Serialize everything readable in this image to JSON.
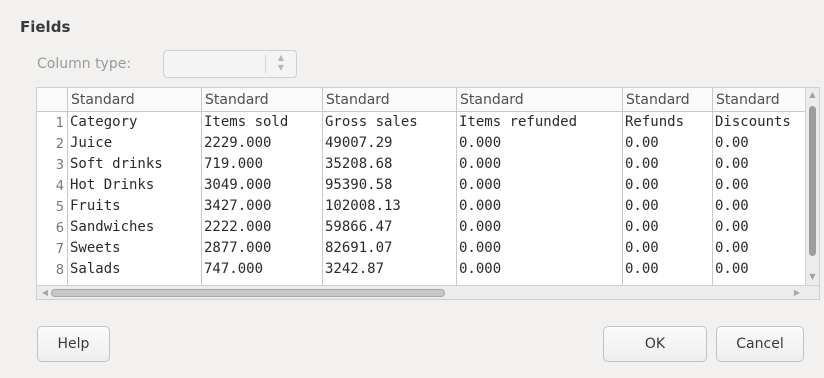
{
  "dialog": {
    "section_title": "Fields",
    "column_type_label": "Column type:",
    "column_type_value": ""
  },
  "grid": {
    "column_types": [
      "Standard",
      "Standard",
      "Standard",
      "Standard",
      "Standard",
      "Standard"
    ],
    "row_numbers": [
      "1",
      "2",
      "3",
      "4",
      "5",
      "6",
      "7",
      "8"
    ],
    "rows": [
      [
        "Category",
        "Items sold",
        "Gross sales",
        "Items refunded",
        "Refunds",
        "Discounts"
      ],
      [
        "Juice",
        "2229.000",
        "49007.29",
        "0.000",
        "0.00",
        "0.00"
      ],
      [
        "Soft drinks",
        "719.000",
        "35208.68",
        "0.000",
        "0.00",
        "0.00"
      ],
      [
        "Hot Drinks",
        "3049.000",
        "95390.58",
        "0.000",
        "0.00",
        "0.00"
      ],
      [
        "Fruits",
        "3427.000",
        "102008.13",
        "0.000",
        "0.00",
        "0.00"
      ],
      [
        "Sandwiches",
        "2222.000",
        "59866.47",
        "0.000",
        "0.00",
        "0.00"
      ],
      [
        "Sweets",
        "2877.000",
        "82691.07",
        "0.000",
        "0.00",
        "0.00"
      ],
      [
        "Salads",
        "747.000",
        "3242.87",
        "0.000",
        "0.00",
        "0.00"
      ]
    ]
  },
  "buttons": {
    "help": "Help",
    "ok": "OK",
    "cancel": "Cancel"
  }
}
